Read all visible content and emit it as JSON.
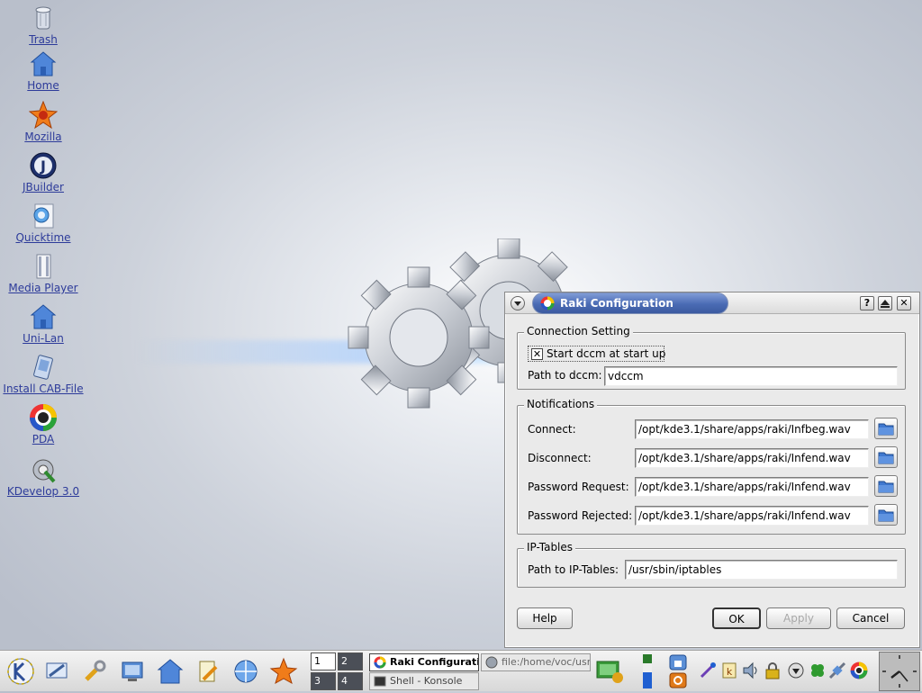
{
  "desktop": {
    "icons": [
      {
        "label": "Trash",
        "icon": "trash-icon"
      },
      {
        "label": "Home",
        "icon": "home-icon"
      },
      {
        "label": "Mozilla",
        "icon": "mozilla-icon"
      },
      {
        "label": "JBuilder",
        "icon": "jbuilder-icon"
      },
      {
        "label": "Quicktime",
        "icon": "quicktime-icon"
      },
      {
        "label": "Media Player",
        "icon": "media-player-icon"
      },
      {
        "label": "Uni-Lan",
        "icon": "uni-lan-icon"
      },
      {
        "label": "Install CAB-File",
        "icon": "install-cab-icon"
      },
      {
        "label": "PDA",
        "icon": "pda-icon"
      },
      {
        "label": "KDevelop 3.0",
        "icon": "kdevelop-icon"
      }
    ]
  },
  "dialog": {
    "title": "Raki Configuration",
    "connection": {
      "group_title": "Connection Setting",
      "start_checkbox_label": "Start dccm at start up",
      "start_checked": true,
      "path_label": "Path to dccm:",
      "path_value": "vdccm"
    },
    "notifications": {
      "group_title": "Notifications",
      "rows": [
        {
          "label": "Connect:",
          "value": "/opt/kde3.1/share/apps/raki/Infbeg.wav"
        },
        {
          "label": "Disconnect:",
          "value": "/opt/kde3.1/share/apps/raki/Infend.wav"
        },
        {
          "label": "Password Request:",
          "value": "/opt/kde3.1/share/apps/raki/Infend.wav"
        },
        {
          "label": "Password Rejected:",
          "value": "/opt/kde3.1/share/apps/raki/Infend.wav"
        }
      ]
    },
    "iptables": {
      "group_title": "IP-Tables",
      "path_label": "Path to IP-Tables:",
      "path_value": "/usr/sbin/iptables"
    },
    "buttons": {
      "help": "Help",
      "ok": "OK",
      "apply": "Apply",
      "cancel": "Cancel"
    }
  },
  "taskbar": {
    "pager": [
      "1",
      "2",
      "3",
      "4"
    ],
    "tasks": [
      {
        "label": "Raki Configuration",
        "active": true
      },
      {
        "label": "file:/home/voc/usr/sc",
        "active": false
      },
      {
        "label": "Shell - Konsole",
        "active": false
      }
    ],
    "colors": {
      "accent": "#4a6bb4"
    }
  }
}
